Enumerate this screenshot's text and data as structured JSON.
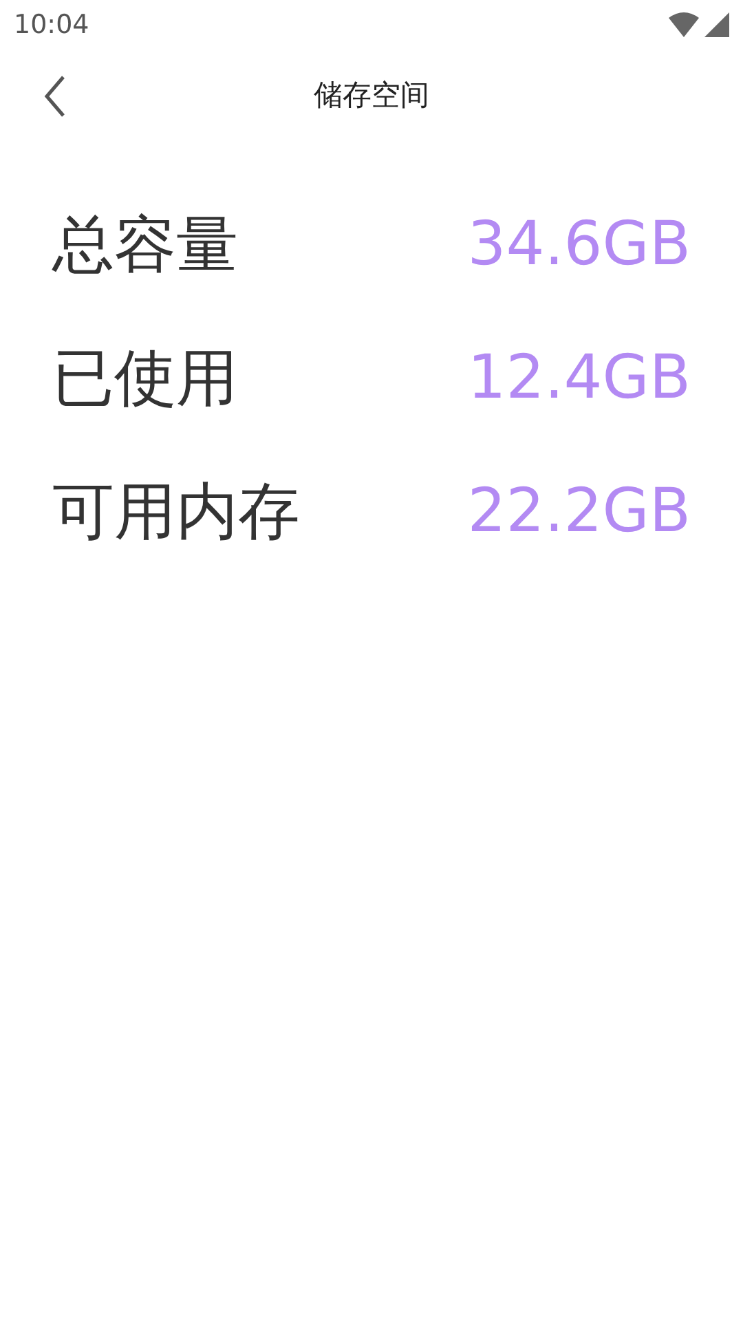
{
  "status_bar": {
    "time": "10:04"
  },
  "header": {
    "title": "储存空间"
  },
  "rows": [
    {
      "label": "总容量",
      "value": "34.6GB"
    },
    {
      "label": "已使用",
      "value": "12.4GB"
    },
    {
      "label": "可用内存",
      "value": "22.2GB"
    }
  ]
}
